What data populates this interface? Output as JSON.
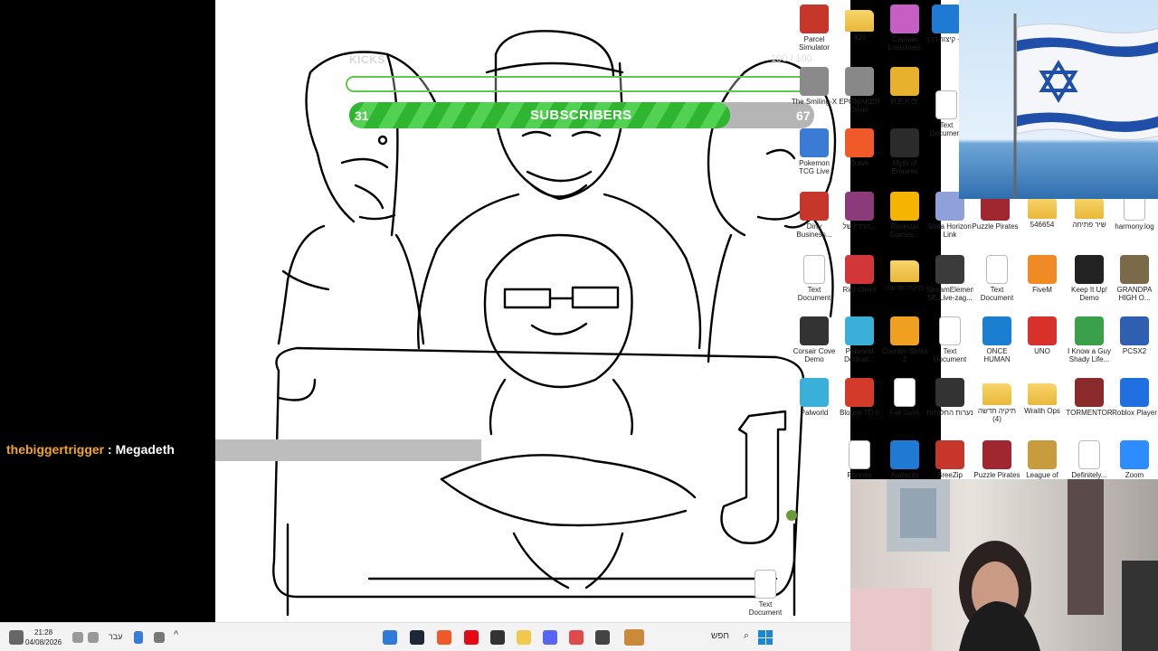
{
  "chat": {
    "username": "thebiggertrigger",
    "separator": " : ",
    "message": "Megadeth"
  },
  "widgets": {
    "kicks": {
      "label": "KICKS",
      "count": "100 / 100"
    },
    "subscribers": {
      "title": "SUBSCRIBERS",
      "current": "31",
      "goal": "67",
      "progress": 0.82
    }
  },
  "desktop_icons": [
    {
      "label": "Parcel Simulator",
      "icon": "parcel-icon",
      "color": "#c7362a"
    },
    {
      "label": "420",
      "icon": "folder-icon",
      "color": "#f2c94c"
    },
    {
      "label": "Captain Lostshoes",
      "icon": "game-icon",
      "color": "#c55fc4"
    },
    {
      "label": "ה - קיצור דרך",
      "icon": "photos-icon",
      "color": "#1f7ad3"
    },
    {
      "label": "The Smiling-X",
      "icon": "game-icon",
      "color": "#8a8a8a"
    },
    {
      "label": "EPOMAKER Driver",
      "icon": "game-icon",
      "color": "#888"
    },
    {
      "label": "R.E.P.O.",
      "icon": "repo-icon",
      "color": "#e7b12e"
    },
    {
      "label": "Text Document",
      "icon": "text-document-icon",
      "color": "#ffffff"
    },
    {
      "label": "Pokemon TCG Live",
      "icon": "pokemon-icon",
      "color": "#3a7bd5"
    },
    {
      "label": "Brave",
      "icon": "brave-icon",
      "color": "#f05a28"
    },
    {
      "label": "Myth of Empires",
      "icon": "myth-icon",
      "color": "#2b2b2b"
    },
    {
      "label": "Dirty Business...",
      "icon": "game-icon",
      "color": "#c7362a"
    },
    {
      "label": "הרדיו של...",
      "icon": "winrar-icon",
      "color": "#8b3a7a"
    },
    {
      "label": "Rockstar Games...",
      "icon": "rockstar-icon",
      "color": "#f4b400"
    },
    {
      "label": "Meta Horizon Link",
      "icon": "meta-icon",
      "color": "#8ea1d9"
    },
    {
      "label": "Puzzle Pirates",
      "icon": "pirates-icon",
      "color": "#a0272f"
    },
    {
      "label": "546654",
      "icon": "folder-icon",
      "color": "#f2c94c"
    },
    {
      "label": "שיר פתיחה",
      "icon": "folder-icon",
      "color": "#f2c94c"
    },
    {
      "label": "harmony.log",
      "icon": "text-document-icon",
      "color": "#ffffff"
    },
    {
      "label": "Text Document",
      "icon": "text-document-icon",
      "color": "#ffffff"
    },
    {
      "label": "Riot Client",
      "icon": "riot-icon",
      "color": "#d13639"
    },
    {
      "label": "תיקיה חדשה",
      "icon": "folder-icon",
      "color": "#f2c94c"
    },
    {
      "label": "StreamElements SE.Live-zag...",
      "icon": "streamelements-icon",
      "color": "#3b3b3b"
    },
    {
      "label": "Text Document",
      "icon": "text-document-icon",
      "color": "#ffffff"
    },
    {
      "label": "FiveM",
      "icon": "fivem-icon",
      "color": "#f08a24"
    },
    {
      "label": "Keep It Up! Demo",
      "icon": "game-icon",
      "color": "#222"
    },
    {
      "label": "GRANDPA HIGH O...",
      "icon": "game-icon",
      "color": "#7a6a4a"
    },
    {
      "label": "Corsair Cove Demo",
      "icon": "game-icon",
      "color": "#333"
    },
    {
      "label": "Palworld Dedicat...",
      "icon": "palworld-icon",
      "color": "#3ab0d8"
    },
    {
      "label": "Counter-Strike 2",
      "icon": "cs2-icon",
      "color": "#f0a020"
    },
    {
      "label": "Text Document",
      "icon": "text-document-icon",
      "color": "#ffffff"
    },
    {
      "label": "ONCE HUMAN",
      "icon": "game-icon",
      "color": "#1a7fd0"
    },
    {
      "label": "UNO",
      "icon": "uno-icon",
      "color": "#d8312b"
    },
    {
      "label": "I Know a Guy Shady Life...",
      "icon": "game-icon",
      "color": "#3aa14a"
    },
    {
      "label": "PCSX2",
      "icon": "pcsx2-icon",
      "color": "#2f5fb0"
    },
    {
      "label": "Palworld",
      "icon": "palworld-icon",
      "color": "#3ab0d8"
    },
    {
      "label": "Bloons TD 6",
      "icon": "bloons-icon",
      "color": "#d23a2a"
    },
    {
      "label": "Fall Guys",
      "icon": "text-document-icon",
      "color": "#ffffff"
    },
    {
      "label": "נערות החלומות",
      "icon": "game-icon",
      "color": "#333"
    },
    {
      "label": "תיקיה חדשה (4)",
      "icon": "folder-icon",
      "color": "#f2c94c"
    },
    {
      "label": "Wraith Ops",
      "icon": "folder-icon",
      "color": "#f2c94c"
    },
    {
      "label": "TORMENTOR",
      "icon": "game-icon",
      "color": "#8a2a2a"
    },
    {
      "label": "Roblox Player",
      "icon": "roblox-icon",
      "color": "#1f6fe0"
    },
    {
      "label": "Fortnite",
      "icon": "text-document-icon",
      "color": "#ffffff"
    },
    {
      "label": "Audacity",
      "icon": "audacity-icon",
      "color": "#1f7ad3"
    },
    {
      "label": "BreeZip",
      "icon": "game-icon",
      "color": "#c7362a"
    },
    {
      "label": "Puzzle Pirates",
      "icon": "pirates-icon",
      "color": "#a0272f"
    },
    {
      "label": "League of Legends",
      "icon": "league-icon",
      "color": "#c89b3c"
    },
    {
      "label": "Definitely...",
      "icon": "text-document-icon",
      "color": "#ffffff"
    },
    {
      "label": "Zoom",
      "icon": "zoom-icon",
      "color": "#2d8cff"
    },
    {
      "label": "Text Document",
      "icon": "text-document-icon",
      "color": "#ffffff"
    }
  ],
  "taskbar": {
    "time": "21:28",
    "date": "04/08/2026",
    "language": "עבר",
    "search_text": "חפש",
    "apps": [
      {
        "icon": "notification-icon",
        "color": "#2f7ad8"
      },
      {
        "icon": "steam-icon",
        "color": "#1b2838"
      },
      {
        "icon": "brave-icon",
        "color": "#f05a28"
      },
      {
        "icon": "netflix-icon",
        "color": "#e50914"
      },
      {
        "icon": "chatgpt-icon",
        "color": "#333333"
      },
      {
        "icon": "file-explorer-icon",
        "color": "#f2c94c"
      },
      {
        "icon": "discord-icon",
        "color": "#5865f2"
      },
      {
        "icon": "paint-icon",
        "color": "#e04a4a"
      },
      {
        "icon": "terminal-icon",
        "color": "#444444"
      }
    ]
  }
}
